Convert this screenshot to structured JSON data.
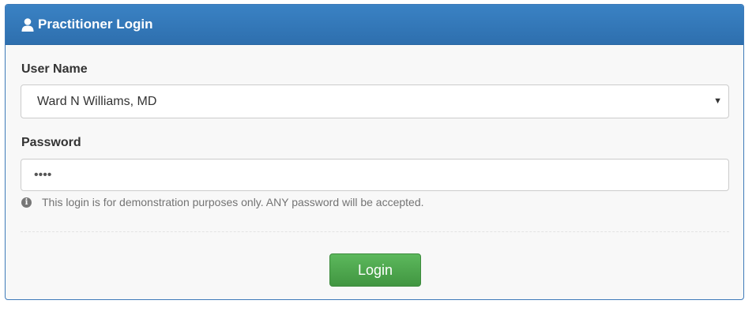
{
  "panel": {
    "title": "Practitioner Login",
    "header_icon": "user-icon",
    "header_color": "#2e6fae"
  },
  "form": {
    "user_name_label": "User Name",
    "user_name_value": "Ward N Williams, MD",
    "password_label": "Password",
    "password_value": "••••",
    "hint_icon": "info-icon",
    "hint_text": "This login is for demonstration purposes only. ANY password will be accepted.",
    "login_label": "Login",
    "login_color": "#4cae4c"
  }
}
